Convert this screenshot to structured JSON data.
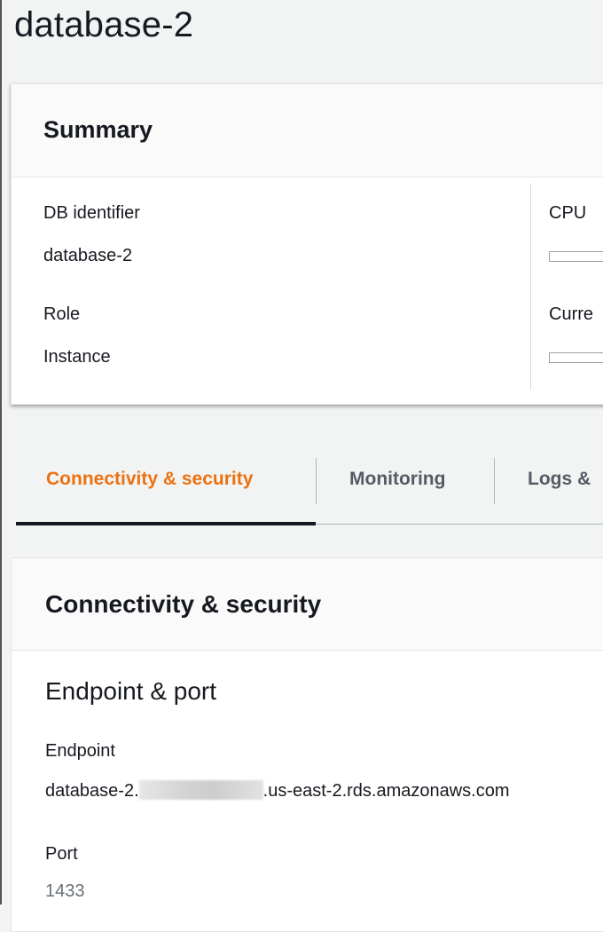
{
  "page": {
    "title": "database-2"
  },
  "summary": {
    "title": "Summary",
    "db_identifier_label": "DB identifier",
    "db_identifier_value": "database-2",
    "role_label": "Role",
    "role_value": "Instance",
    "cpu_label": "CPU",
    "current_label_truncated": "Curre"
  },
  "tabs": [
    {
      "label": "Connectivity & security",
      "active": true
    },
    {
      "label": "Monitoring",
      "active": false
    },
    {
      "label": "Logs &",
      "active": false
    }
  ],
  "connectivity": {
    "title": "Connectivity & security",
    "section_title": "Endpoint & port",
    "endpoint_label": "Endpoint",
    "endpoint_prefix": "database-2.",
    "endpoint_suffix": ".us-east-2.rds.amazonaws.com",
    "port_label": "Port",
    "port_value": "1433"
  },
  "colors": {
    "accent_active_tab": "#ec7211",
    "text_primary": "#16191f",
    "text_muted": "#687078"
  }
}
